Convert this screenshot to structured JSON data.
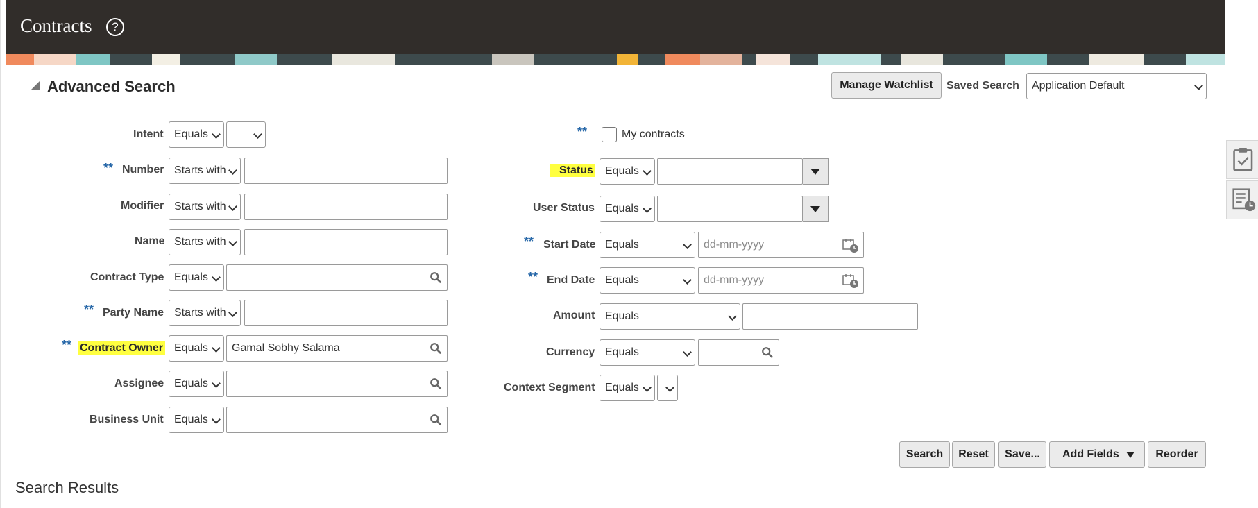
{
  "page": {
    "title": "Contracts"
  },
  "advanced_search": {
    "title": "Advanced Search",
    "manage_watchlist": "Manage Watchlist",
    "saved_search_label": "Saved Search",
    "saved_search_value": "Application Default"
  },
  "left_fields": {
    "intent": {
      "label": "Intent",
      "operator": "Equals",
      "value": ""
    },
    "number": {
      "label": "Number",
      "operator": "Starts with",
      "value": ""
    },
    "modifier": {
      "label": "Modifier",
      "operator": "Starts with",
      "value": ""
    },
    "name": {
      "label": "Name",
      "operator": "Starts with",
      "value": ""
    },
    "contract_type": {
      "label": "Contract Type",
      "operator": "Equals",
      "value": ""
    },
    "party_name": {
      "label": "Party Name",
      "operator": "Starts with",
      "value": ""
    },
    "contract_owner": {
      "label": "Contract Owner",
      "operator": "Equals",
      "value": "Gamal Sobhy Salama"
    },
    "assignee": {
      "label": "Assignee",
      "operator": "Equals",
      "value": ""
    },
    "business_unit": {
      "label": "Business Unit",
      "operator": "Equals",
      "value": ""
    }
  },
  "right_fields": {
    "my_contracts": {
      "label": "My contracts",
      "checked": false
    },
    "status": {
      "label": "Status",
      "operator": "Equals",
      "value": ""
    },
    "user_status": {
      "label": "User Status",
      "operator": "Equals",
      "value": ""
    },
    "start_date": {
      "label": "Start Date",
      "operator": "Equals",
      "placeholder": "dd-mm-yyyy"
    },
    "end_date": {
      "label": "End Date",
      "operator": "Equals",
      "placeholder": "dd-mm-yyyy"
    },
    "amount": {
      "label": "Amount",
      "operator": "Equals",
      "value": ""
    },
    "currency": {
      "label": "Currency",
      "operator": "Equals",
      "value": ""
    },
    "context_segment": {
      "label": "Context Segment",
      "operator": "Equals",
      "value": ""
    }
  },
  "required_marker": "**",
  "actions": {
    "search": "Search",
    "reset": "Reset",
    "save": "Save...",
    "add_fields": "Add Fields",
    "reorder": "Reorder"
  },
  "results": {
    "title": "Search Results"
  },
  "colors": {
    "header_bg": "#312d2a",
    "highlight": "#ffff40",
    "required": "#2667a8"
  }
}
